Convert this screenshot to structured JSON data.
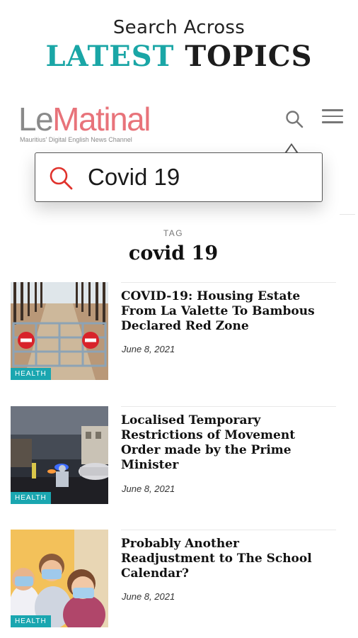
{
  "promo": {
    "line1": "Search Across",
    "line2_accent": "LATEST",
    "line2_rest": "TOPICS"
  },
  "header": {
    "logo_le": "Le",
    "logo_matinal": "Matinal",
    "tagline": "Mauritius' Digital English News Channel",
    "search_icon": "search-icon",
    "menu_icon": "hamburger-menu-icon"
  },
  "search": {
    "value": "Covid 19",
    "icon": "search-icon"
  },
  "tag": {
    "label": "TAG",
    "title": "covid 19"
  },
  "articles": [
    {
      "category": "HEALTH",
      "title": "COVID-19: Housing Estate From La Valette To Bambous Declared Red Zone",
      "date": "June 8, 2021"
    },
    {
      "category": "HEALTH",
      "title": "Localised Temporary Restrictions of Movement Order made by the Prime Minister",
      "date": "June 8, 2021"
    },
    {
      "category": "HEALTH",
      "title": "Probably Another Readjustment to The School Calendar?",
      "date": "June 8, 2021"
    }
  ],
  "colors": {
    "accent_teal": "#1aa6a6",
    "logo_pink": "#e8737a",
    "search_icon_red": "#e0322c",
    "badge_teal": "#1aa6b0"
  }
}
